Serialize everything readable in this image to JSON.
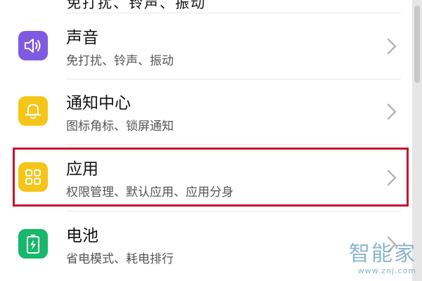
{
  "top_cut_text": "免打扰、铃声、振动",
  "items": [
    {
      "title": "声音",
      "subtitle": "免打扰、铃声、振动",
      "icon": "speaker-icon",
      "icon_bg": "#7f5ae0"
    },
    {
      "title": "通知中心",
      "subtitle": "图标角标、锁屏通知",
      "icon": "bell-icon",
      "icon_bg": "#f5c518"
    },
    {
      "title": "应用",
      "subtitle": "权限管理、默认应用、应用分身",
      "icon": "apps-grid-icon",
      "icon_bg": "#f5c518"
    },
    {
      "title": "电池",
      "subtitle": "省电模式、耗电排行",
      "icon": "battery-icon",
      "icon_bg": "#18b86a"
    }
  ],
  "highlight_color": "#c8102e",
  "watermark": {
    "main": "智能家",
    "sub": "www.znj.com"
  }
}
